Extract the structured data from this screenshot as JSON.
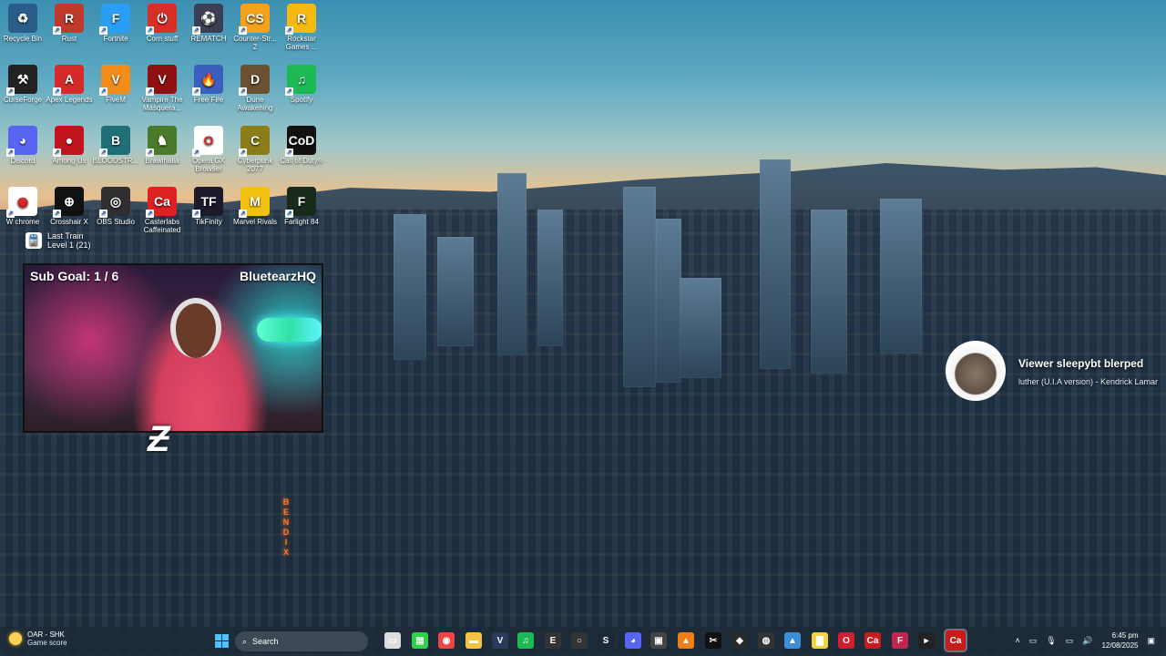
{
  "desktop_icons": [
    {
      "label": "Recycle Bin",
      "glyph": "♻",
      "color": "#2b5d8a"
    },
    {
      "label": "Rust",
      "glyph": "R",
      "color": "#c0392b"
    },
    {
      "label": "Fortnite",
      "glyph": "F",
      "color": "#2a9df4"
    },
    {
      "label": "Corn stuff",
      "glyph": "⏻",
      "color": "#d93025"
    },
    {
      "label": "REMATCH",
      "glyph": "⚽",
      "color": "#3b3f55"
    },
    {
      "label": "Counter-Str... 2",
      "glyph": "CS",
      "color": "#f4a21b"
    },
    {
      "label": "Rockstar Games ...",
      "glyph": "R",
      "color": "#f5b90f"
    },
    {
      "label": "CurseForge",
      "glyph": "⚒",
      "color": "#222"
    },
    {
      "label": "Apex Legends",
      "glyph": "A",
      "color": "#d62a2a"
    },
    {
      "label": "FiveM",
      "glyph": "V",
      "color": "#f28c1a"
    },
    {
      "label": "Vampire The Masquera...",
      "glyph": "V",
      "color": "#8e1111"
    },
    {
      "label": "Free Fire",
      "glyph": "🔥",
      "color": "#3a5fbf"
    },
    {
      "label": "Dune Awakening",
      "glyph": "D",
      "color": "#6b5131"
    },
    {
      "label": "Spotify",
      "glyph": "♫",
      "color": "#1db954"
    },
    {
      "label": "Discord",
      "glyph": "◕",
      "color": "#5865f2"
    },
    {
      "label": "Among Us",
      "glyph": "●",
      "color": "#c0141e"
    },
    {
      "label": "BLOODSTR...",
      "glyph": "B",
      "color": "#1f6f78"
    },
    {
      "label": "Brawlhalla",
      "glyph": "♞",
      "color": "#4a7a2a"
    },
    {
      "label": "Opera GX Browser",
      "glyph": "O",
      "color": "#fff"
    },
    {
      "label": "Cyberpunk 2077",
      "glyph": "C",
      "color": "#8a7d1a"
    },
    {
      "label": "Call of Duty®",
      "glyph": "CoD",
      "color": "#111"
    },
    {
      "label": "W chrome",
      "glyph": "◉",
      "color": "#fff"
    },
    {
      "label": "Crosshair X",
      "glyph": "⊕",
      "color": "#111"
    },
    {
      "label": "OBS Studio",
      "glyph": "◎",
      "color": "#302e31"
    },
    {
      "label": "Casterlabs Caffeinated",
      "glyph": "Ca",
      "color": "#d22"
    },
    {
      "label": "TikFinity",
      "glyph": "TF",
      "color": "#1a1a2a"
    },
    {
      "label": "Marvel Rivals",
      "glyph": "M",
      "color": "#f2c10f"
    },
    {
      "label": "Farlight 84",
      "glyph": "F",
      "color": "#1a2a1a"
    }
  ],
  "last_train": {
    "title": "Last Train",
    "level": "Level 1  (21)"
  },
  "webcam": {
    "sub_goal": "Sub Goal:  1 / 6",
    "handle": "BluetearzHQ"
  },
  "sign": "BENDIX",
  "alert": {
    "title": "Viewer sleepybt blerped",
    "song": "luther (U.I.A version) - Kendrick Lamar"
  },
  "taskbar": {
    "weather_title": "OAR - SHK",
    "weather_sub": "Game score",
    "search_placeholder": "Search",
    "time": "6:45 pm",
    "date": "12/08/2025",
    "apps": [
      {
        "name": "file-explorer-icon",
        "glyph": "▭",
        "color": "#ddd"
      },
      {
        "name": "xbox-icon",
        "glyph": "▤",
        "color": "#2fd14b"
      },
      {
        "name": "chrome-icon",
        "glyph": "◉",
        "color": "#e44"
      },
      {
        "name": "folder-icon",
        "glyph": "▬",
        "color": "#f5c242"
      },
      {
        "name": "vscode-icon",
        "glyph": "V",
        "color": "#2a3a5a"
      },
      {
        "name": "spotify-icon",
        "glyph": "♫",
        "color": "#1db954"
      },
      {
        "name": "epic-icon",
        "glyph": "E",
        "color": "#333"
      },
      {
        "name": "app-ring-icon",
        "glyph": "○",
        "color": "#333"
      },
      {
        "name": "steam-icon",
        "glyph": "S",
        "color": "#1b2838"
      },
      {
        "name": "discord-icon",
        "glyph": "◕",
        "color": "#5865f2"
      },
      {
        "name": "app-dark-icon",
        "glyph": "▣",
        "color": "#444"
      },
      {
        "name": "vlc-icon",
        "glyph": "▲",
        "color": "#f07e16"
      },
      {
        "name": "capcut-icon",
        "glyph": "✂",
        "color": "#111"
      },
      {
        "name": "app-emblem-icon",
        "glyph": "◆",
        "color": "#2a2a2a"
      },
      {
        "name": "browser-icon",
        "glyph": "◍",
        "color": "#333"
      },
      {
        "name": "photos-icon",
        "glyph": "▲",
        "color": "#3b8fd8"
      },
      {
        "name": "sticky-notes-icon",
        "glyph": "▇",
        "color": "#f3d33b"
      },
      {
        "name": "opera-gx-icon",
        "glyph": "O",
        "color": "#d21c2f"
      },
      {
        "name": "casterlabs-icon",
        "glyph": "Ca",
        "color": "#c61c1c"
      },
      {
        "name": "app-f-icon",
        "glyph": "F",
        "color": "#c3244e"
      },
      {
        "name": "nvidia-icon",
        "glyph": "▸",
        "color": "#222"
      },
      {
        "name": "casterlabs-active-icon",
        "glyph": "Ca",
        "color": "#c61c1c"
      }
    ]
  }
}
